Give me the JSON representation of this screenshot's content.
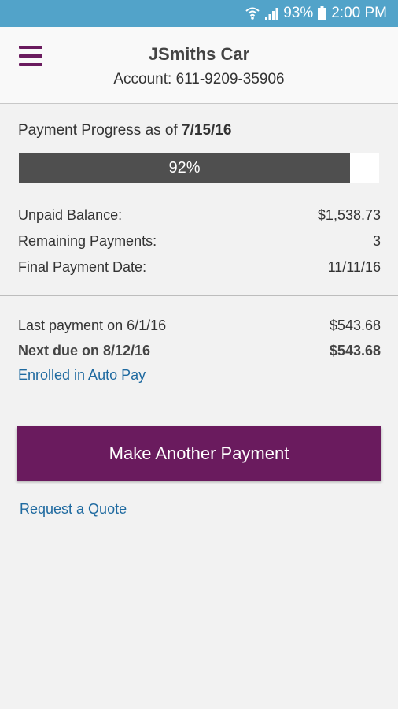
{
  "status_bar": {
    "battery": "93%",
    "time": "2:00 PM",
    "icons": [
      "wifi-icon",
      "signal-icon",
      "battery-icon"
    ]
  },
  "header": {
    "title": "JSmiths Car",
    "account": "Account: 611-9209-35906",
    "menu_icon": "hamburger-menu-icon"
  },
  "progress": {
    "label_prefix": "Payment Progress as of",
    "date": "7/15/16",
    "percent": 92,
    "percent_label": "92%"
  },
  "details": [
    {
      "label": "Unpaid Balance:",
      "value": "$1,538.73"
    },
    {
      "label": "Remaining Payments:",
      "value": "3"
    },
    {
      "label": "Final Payment Date:",
      "value": "11/11/16"
    }
  ],
  "payments": {
    "last_label": "Last payment on 6/1/16",
    "last_amount": "$543.68",
    "next_label": "Next due on 8/12/16",
    "next_amount": "$543.68",
    "auto_pay": "Enrolled in Auto Pay"
  },
  "actions": {
    "make_payment": "Make Another Payment",
    "request_quote": "Request a Quote"
  },
  "colors": {
    "status_bar": "#52a3c9",
    "brand_purple": "#6a1b5e",
    "progress_fill": "#4f4f4f",
    "link_blue": "#1f6aa0"
  }
}
